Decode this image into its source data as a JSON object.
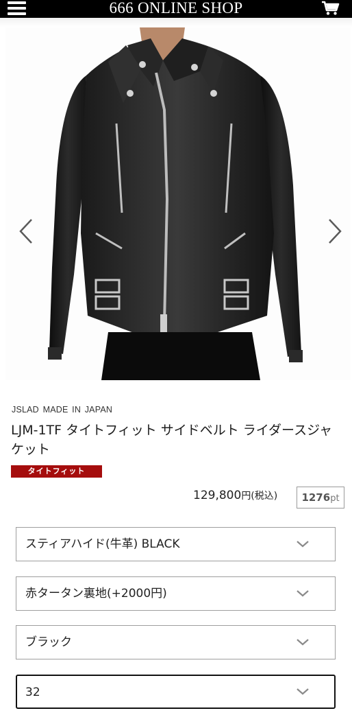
{
  "header": {
    "title": "666 ONLINE SHOP",
    "menu_icon": "hamburger-menu-icon",
    "cart_icon": "shopping-cart-icon",
    "background": "#000000"
  },
  "gallery": {
    "image": "black leather rider's jacket worn by model",
    "prev_icon": "chevron-left-icon",
    "next_icon": "chevron-right-icon"
  },
  "product": {
    "brand_line": "JSLAD  MADE IN JAPAN",
    "title": "LJM-1TF タイトフィット サイドベルト ライダースジャケット",
    "badge": "タイトフィット",
    "badge_color": "#a50d0d",
    "price": "129,800",
    "price_unit": "円(税込)",
    "points_value": "1276",
    "points_unit": "pt"
  },
  "options": {
    "leather": "スティアハイド(牛革) BLACK",
    "lining": "赤タータン裏地(+2000円)",
    "color": "ブラック",
    "size": "32"
  }
}
